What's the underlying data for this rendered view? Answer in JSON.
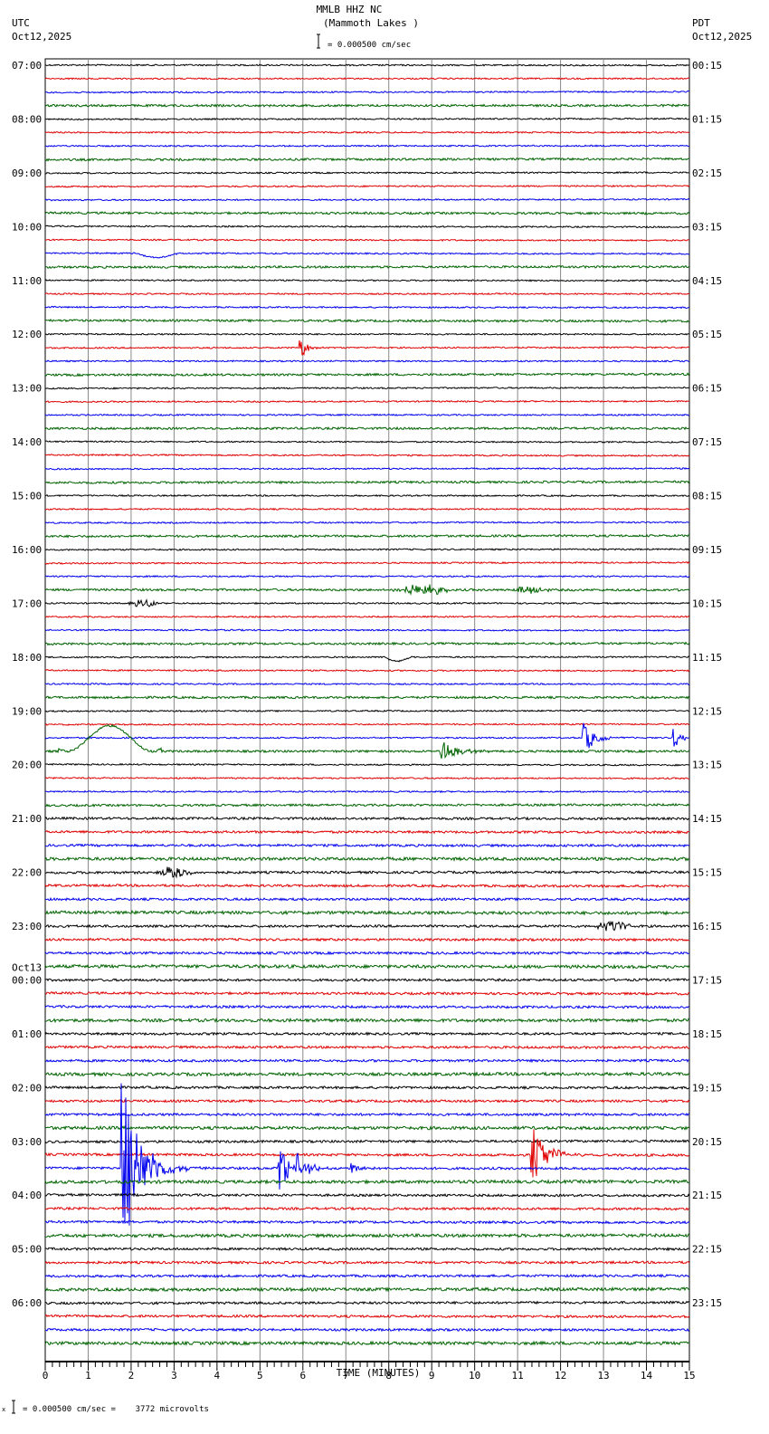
{
  "header": {
    "title": "MMLB HHZ NC",
    "subtitle": "(Mammoth Lakes )",
    "scale_text": "= 0.000500 cm/sec",
    "left_tz": "UTC",
    "left_date": "Oct12,2025",
    "right_tz": "PDT",
    "right_date": "Oct12,2025"
  },
  "footer": {
    "scale_text": "= 0.000500 cm/sec =    3772 microvolts",
    "scale_prefix": "x"
  },
  "chart_data": {
    "type": "line",
    "title": "MMLB HHZ NC (Mammoth Lakes )",
    "xlabel": "TIME (MINUTES)",
    "xlim": [
      0,
      15
    ],
    "x_ticks": [
      "0",
      "1",
      "2",
      "3",
      "4",
      "5",
      "6",
      "7",
      "8",
      "9",
      "10",
      "11",
      "12",
      "13",
      "14",
      "15"
    ],
    "grid": true,
    "trace_colors": [
      "#000000",
      "#e00000",
      "#0000ee",
      "#006400"
    ],
    "traces_per_hour": 4,
    "left_labels": [
      "07:00",
      "08:00",
      "09:00",
      "10:00",
      "11:00",
      "12:00",
      "13:00",
      "14:00",
      "15:00",
      "16:00",
      "17:00",
      "18:00",
      "19:00",
      "20:00",
      "21:00",
      "22:00",
      "23:00",
      "00:00",
      "01:00",
      "02:00",
      "03:00",
      "04:00",
      "05:00",
      "06:00"
    ],
    "left_date_change": {
      "label": "Oct13",
      "before": "00:00"
    },
    "right_labels": [
      "00:15",
      "01:15",
      "02:15",
      "03:15",
      "04:15",
      "05:15",
      "06:15",
      "07:15",
      "08:15",
      "09:15",
      "10:15",
      "11:15",
      "12:15",
      "13:15",
      "14:15",
      "15:15",
      "16:15",
      "17:15",
      "18:15",
      "19:15",
      "20:15",
      "21:15",
      "22:15",
      "23:15"
    ],
    "events": [
      {
        "trace": 14,
        "minute": 2.6,
        "amplitude": 0.3,
        "duration": 1.0,
        "kind": "dip"
      },
      {
        "trace": 21,
        "minute": 5.95,
        "amplitude": 1.0,
        "duration": 0.25,
        "kind": "quake"
      },
      {
        "trace": 39,
        "minute": 8.0,
        "amplitude": 0.4,
        "duration": 1.5,
        "kind": "burst"
      },
      {
        "trace": 39,
        "minute": 10.8,
        "amplitude": 0.3,
        "duration": 1.0,
        "kind": "burst"
      },
      {
        "trace": 40,
        "minute": 1.9,
        "amplitude": 0.3,
        "duration": 0.8,
        "kind": "burst"
      },
      {
        "trace": 44,
        "minute": 8.2,
        "amplitude": 0.3,
        "duration": 0.6,
        "kind": "dip"
      },
      {
        "trace": 50,
        "minute": 12.55,
        "amplitude": 1.2,
        "duration": 0.5,
        "kind": "quake"
      },
      {
        "trace": 50,
        "minute": 14.65,
        "amplitude": 0.8,
        "duration": 0.3,
        "kind": "quake"
      },
      {
        "trace": 51,
        "minute": 1.5,
        "amplitude": 1.9,
        "duration": 2.0,
        "kind": "bump"
      },
      {
        "trace": 51,
        "minute": 9.25,
        "amplitude": 0.9,
        "duration": 0.6,
        "kind": "quake"
      },
      {
        "trace": 60,
        "minute": 2.5,
        "amplitude": 0.4,
        "duration": 1.0,
        "kind": "burst"
      },
      {
        "trace": 64,
        "minute": 12.7,
        "amplitude": 0.4,
        "duration": 1.0,
        "kind": "burst"
      },
      {
        "trace": 81,
        "minute": 11.35,
        "amplitude": 2.5,
        "duration": 0.6,
        "kind": "quake"
      },
      {
        "trace": 82,
        "minute": 1.8,
        "amplitude": 6.5,
        "duration": 0.8,
        "kind": "quake"
      },
      {
        "trace": 82,
        "minute": 5.45,
        "amplitude": 1.7,
        "duration": 0.5,
        "kind": "quake"
      },
      {
        "trace": 82,
        "minute": 5.9,
        "amplitude": 1.2,
        "duration": 0.4,
        "kind": "quake"
      },
      {
        "trace": 82,
        "minute": 7.15,
        "amplitude": 0.6,
        "duration": 0.3,
        "kind": "quake"
      }
    ]
  }
}
